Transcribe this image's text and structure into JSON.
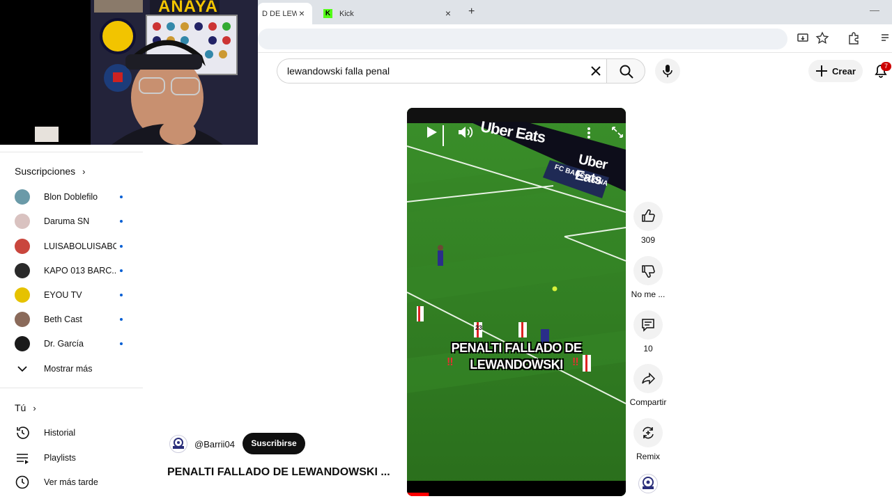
{
  "browser": {
    "tabs": [
      {
        "label": "D DE LEWA",
        "active": true
      },
      {
        "label": "Kick",
        "active": false
      }
    ],
    "new_tab": "+"
  },
  "webcam": {
    "sign_text": "ANAYA"
  },
  "search": {
    "query": "lewandowski falla penal"
  },
  "masthead": {
    "create_label": "Crear",
    "notification_count": "7"
  },
  "sidebar": {
    "subscriptions_title": "Suscripciones",
    "subscriptions": [
      {
        "name": "Blon Doblefilo",
        "color": "#6a9aa8"
      },
      {
        "name": "Daruma SN",
        "color": "#d9c2c0"
      },
      {
        "name": "LUISABOLUISABO",
        "color": "#c9463d"
      },
      {
        "name": "KAPO 013 BARC...",
        "color": "#2a2a2a"
      },
      {
        "name": "EYOU TV",
        "color": "#e6c200"
      },
      {
        "name": "Beth Cast",
        "color": "#8a6a5a"
      },
      {
        "name": "Dr. García",
        "color": "#1a1a1a"
      }
    ],
    "show_more": "Mostrar más",
    "you_title": "Tú",
    "you_items": [
      {
        "label": "Historial",
        "icon": "history-icon"
      },
      {
        "label": "Playlists",
        "icon": "playlist-icon"
      },
      {
        "label": "Ver más tarde",
        "icon": "clock-icon"
      }
    ]
  },
  "video": {
    "caption_line1": "PENALTI FALLADO DE",
    "caption_line2": "LEWANDOWSKI",
    "ad_text_1": "Uber Eats",
    "ad_text_2": "Uber Eats",
    "board_text": "FC BARCELONA",
    "shirt_number": "23",
    "progress": 0.1
  },
  "actions": {
    "likes": "309",
    "dislike_label": "No me ...",
    "comments": "10",
    "share_label": "Compartir",
    "remix_label": "Remix"
  },
  "channel": {
    "handle": "@Barrii04",
    "subscribe_label": "Suscribirse",
    "title": "PENALTI FALLADO DE LEWANDOWSKI ..."
  }
}
